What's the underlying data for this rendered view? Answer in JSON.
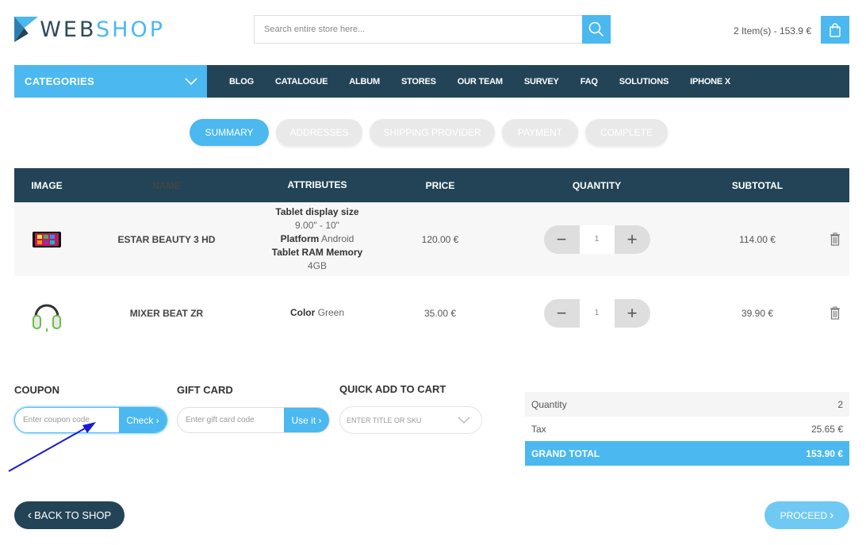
{
  "header": {
    "logo_web": "WEB",
    "logo_shop": "SHOP",
    "search_placeholder": "Search entire store here...",
    "cart_summary": "2 Item(s) - 153.9 €"
  },
  "nav": {
    "categories_label": "CATEGORIES",
    "items": [
      "BLOG",
      "CATALOGUE",
      "ALBUM",
      "STORES",
      "OUR TEAM",
      "SURVEY",
      "FAQ",
      "SOLUTIONS",
      "IPHONE X"
    ]
  },
  "steps": [
    {
      "label": "SUMMARY",
      "active": true
    },
    {
      "label": "ADDRESSES",
      "active": false
    },
    {
      "label": "SHIPPING PROVIDER",
      "active": false
    },
    {
      "label": "PAYMENT",
      "active": false
    },
    {
      "label": "COMPLETE",
      "active": false
    }
  ],
  "table": {
    "headers": [
      "IMAGE",
      "NAME",
      "ATTRIBUTES",
      "PRICE",
      "QUANTITY",
      "SUBTOTAL"
    ],
    "rows": [
      {
        "name": "ESTAR BEAUTY 3 HD",
        "attributes": [
          {
            "key": "Tablet display size",
            "value": "9.00\" - 10\""
          },
          {
            "key": "Platform",
            "value": "Android"
          },
          {
            "key": "Tablet RAM Memory",
            "value": "4GB"
          }
        ],
        "price": "120.00 €",
        "quantity": "1",
        "subtotal": "114.00 €"
      },
      {
        "name": "MIXER BEAT ZR",
        "attributes": [
          {
            "key": "Color",
            "value": "Green"
          }
        ],
        "price": "35.00 €",
        "quantity": "1",
        "subtotal": "39.90 €"
      }
    ]
  },
  "coupon": {
    "label": "COUPON",
    "placeholder": "Enter coupon code",
    "button": "Check"
  },
  "giftcard": {
    "label": "GIFT CARD",
    "placeholder": "Enter gift card code",
    "button": "Use it"
  },
  "quickadd": {
    "label": "QUICK ADD TO CART",
    "placeholder": "ENTER TITLE OR SKU"
  },
  "totals": {
    "quantity_label": "Quantity",
    "quantity_value": "2",
    "tax_label": "Tax",
    "tax_value": "25.65 €",
    "grand_label": "GRAND TOTAL",
    "grand_value": "153.90 €"
  },
  "footer": {
    "back_label": "BACK TO SHOP",
    "proceed_label": "PROCEED"
  },
  "colors": {
    "accent": "#4bb8f0",
    "dark": "#234457",
    "annotation": "#1a1ad6"
  }
}
